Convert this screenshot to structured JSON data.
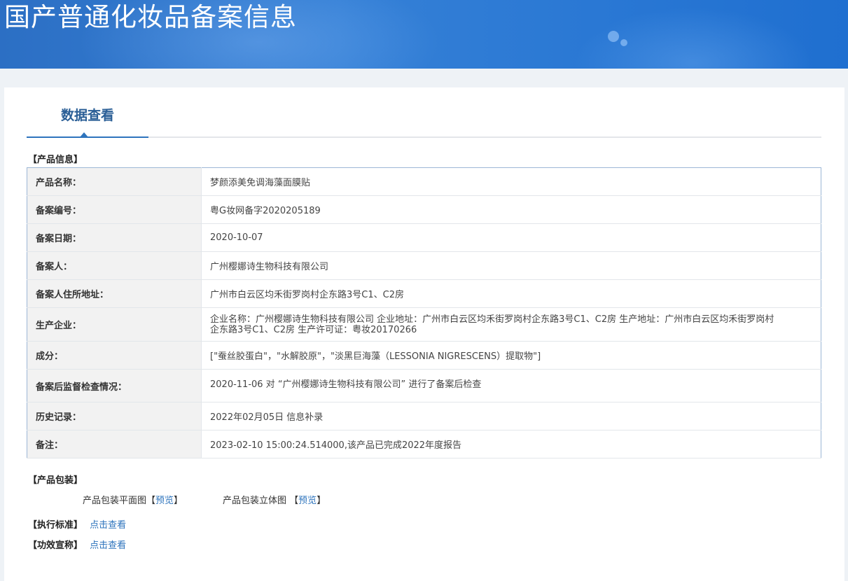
{
  "banner": {
    "title": "国产普通化妆品备案信息"
  },
  "tabs": [
    {
      "label": "数据查看",
      "active": true
    }
  ],
  "sections": {
    "product_info": "【产品信息】",
    "packaging": "【产品包装】",
    "standard": "【执行标准】",
    "efficacy": "【功效宣称】"
  },
  "product_table": [
    {
      "label": "产品名称：",
      "value": "梦颜添美免调海藻面膜贴"
    },
    {
      "label": "备案编号：",
      "value": "粤G妆网备字2020205189"
    },
    {
      "label": "备案日期：",
      "value": "2020-10-07"
    },
    {
      "label": "备案人：",
      "value": "广州樱娜诗生物科技有限公司"
    },
    {
      "label": "备案人住所地址：",
      "value": "广州市白云区均禾街罗岗村企东路3号C1、C2房"
    },
    {
      "label": "生产企业：",
      "value": "企业名称：广州樱娜诗生物科技有限公司 企业地址：广州市白云区均禾街罗岗村企东路3号C1、C2房 生产地址：广州市白云区均禾街罗岗村企东路3号C1、C2房 生产许可证：粤妆20170266"
    },
    {
      "label": "成分：",
      "value": "[\"蚕丝胶蛋白\"，\"水解胶原\"，\"淡黑巨海藻（LESSONIA NIGRESCENS）提取物\"]"
    },
    {
      "label": "备案后监督检查情况：",
      "value": "2020-11-06 对 “广州樱娜诗生物科技有限公司” 进行了备案后检查"
    },
    {
      "label": "历史记录：",
      "value": "2022年02月05日 信息补录"
    },
    {
      "label": "备注：",
      "value": "2023-02-10 15:00:24.514000,该产品已完成2022年度报告"
    }
  ],
  "packaging": {
    "flat_label": "产品包装平面图",
    "flat_link": "预览",
    "threed_label": "产品包装立体图",
    "threed_link": "预览",
    "bracket_open": "【",
    "bracket_close": "】"
  },
  "links": {
    "standard": "点击查看",
    "efficacy": "点击查看"
  },
  "colors": {
    "banner": "#2c6fc4",
    "accent": "#2e74bd",
    "tab_text": "#2a5e96"
  }
}
